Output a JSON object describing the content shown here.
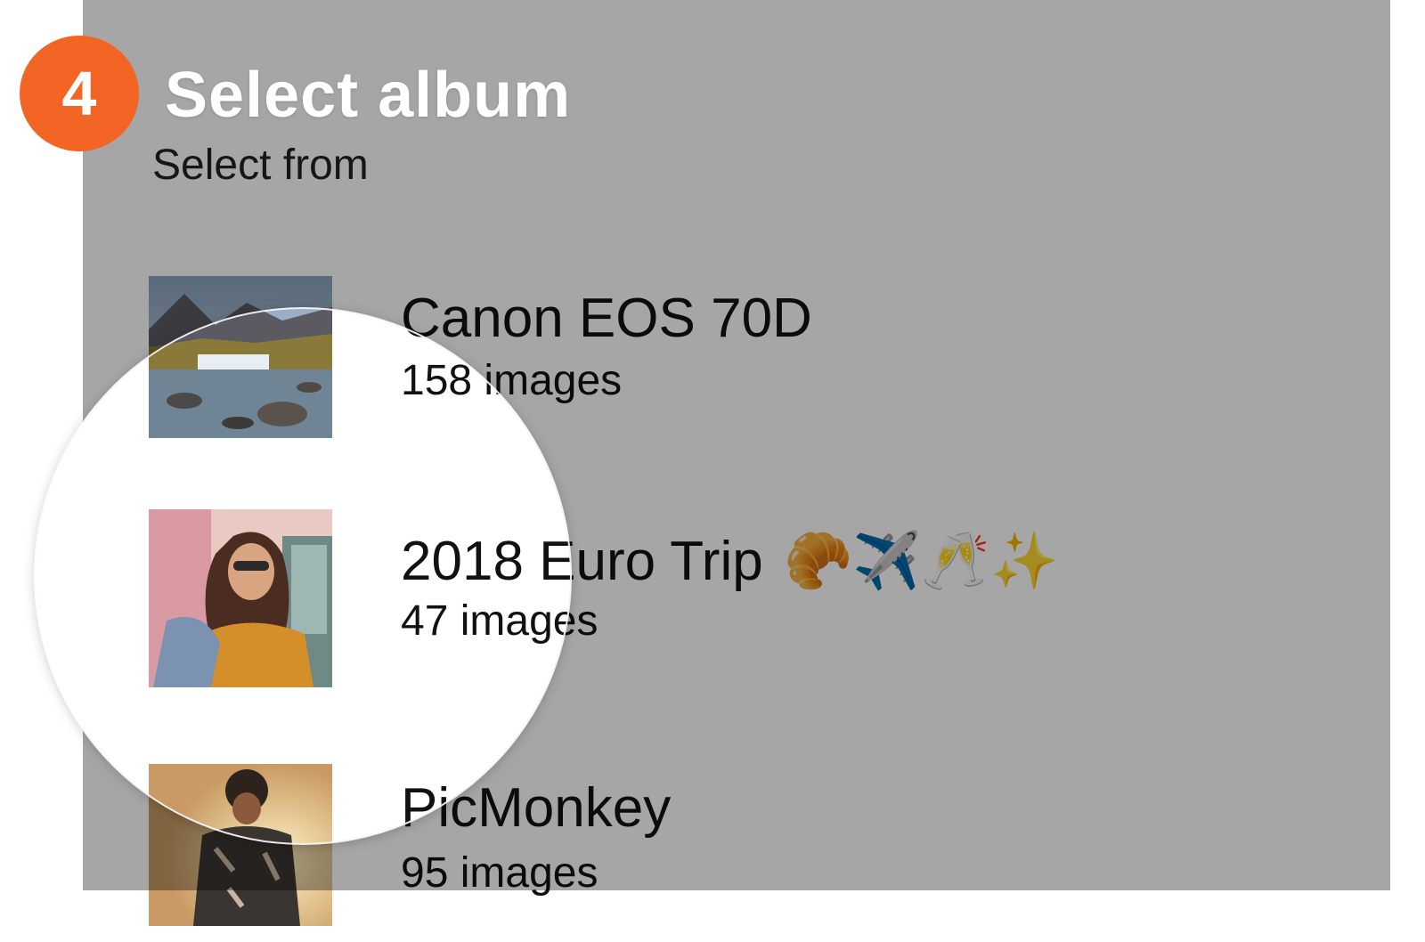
{
  "step": {
    "number": "4",
    "color": "#f26524"
  },
  "header": {
    "title": "Select album",
    "subtitle": "Select from"
  },
  "albums": [
    {
      "name": "Canon EOS 70D",
      "count": "158 images",
      "thumb_icon": "waterfall-landscape-thumbnail"
    },
    {
      "name": "2018 Euro Trip",
      "emoji": "🥐✈️🥂✨",
      "count": "47 images",
      "thumb_icon": "woman-sunglasses-thumbnail"
    },
    {
      "name": "PicMonkey",
      "count": "95 images",
      "thumb_icon": "man-sunset-thumbnail"
    }
  ]
}
